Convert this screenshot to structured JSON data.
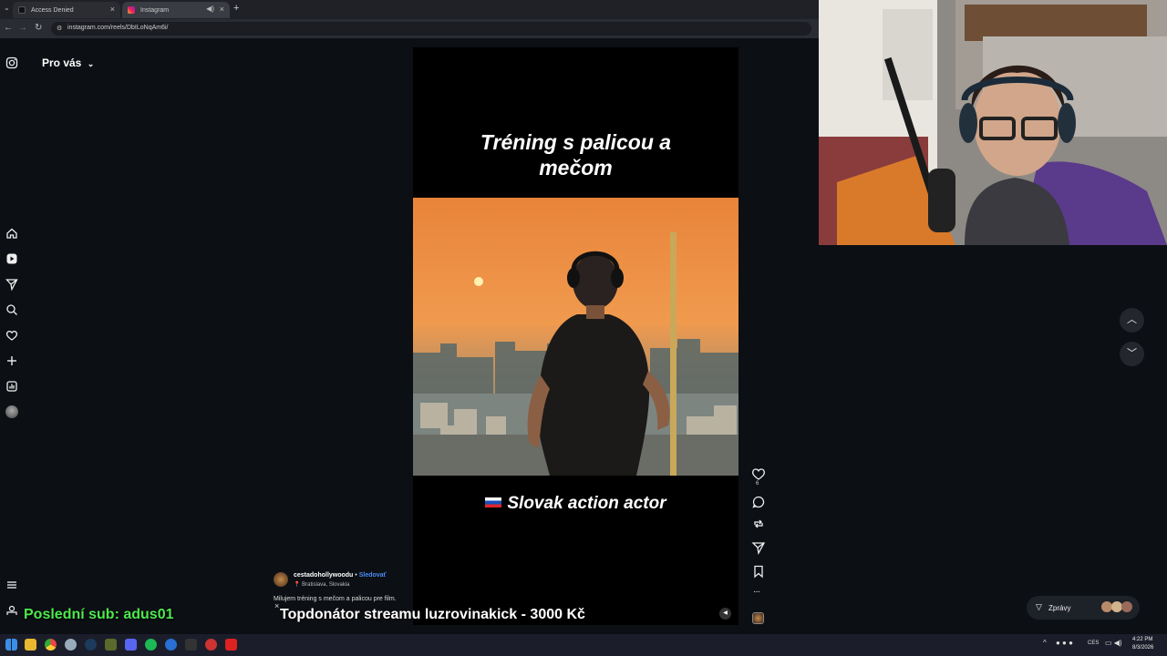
{
  "browser": {
    "tabs": [
      {
        "title": "Access Denied",
        "color": "#2b2d33"
      },
      {
        "title": "Instagram",
        "color": "#3a3c43"
      }
    ],
    "url": "instagram.com/reels/DbILoNqAm6i/"
  },
  "header": {
    "feed_label": "Pro vás"
  },
  "sidebar": {
    "icons": [
      "home-icon",
      "reels-icon",
      "send-icon",
      "search-icon",
      "heart-icon",
      "create-icon",
      "dashboard-icon",
      "profile-icon"
    ]
  },
  "reel": {
    "top_caption": "Tréning s palicou a mečom",
    "bottom_caption": "Slovak action actor",
    "author": "cestadohollywoodu",
    "follow": "Sledovať",
    "location": "Bratislava, Slovakia",
    "description": "Milujem tréning s mečom a palicou pre film.",
    "like_count": "6"
  },
  "overlay": {
    "last_sub": "Poslední sub: adus01",
    "top_donor": "Topdonátor streamu luzrovinakick - 3000 Kč"
  },
  "messages": {
    "label": "Zprávy"
  },
  "taskbar": {
    "lang": "CES",
    "time": "4:22 PM",
    "date": "8/3/2026"
  },
  "colors": {
    "accent_green": "#4de84d",
    "follow_blue": "#4a8cf7"
  }
}
